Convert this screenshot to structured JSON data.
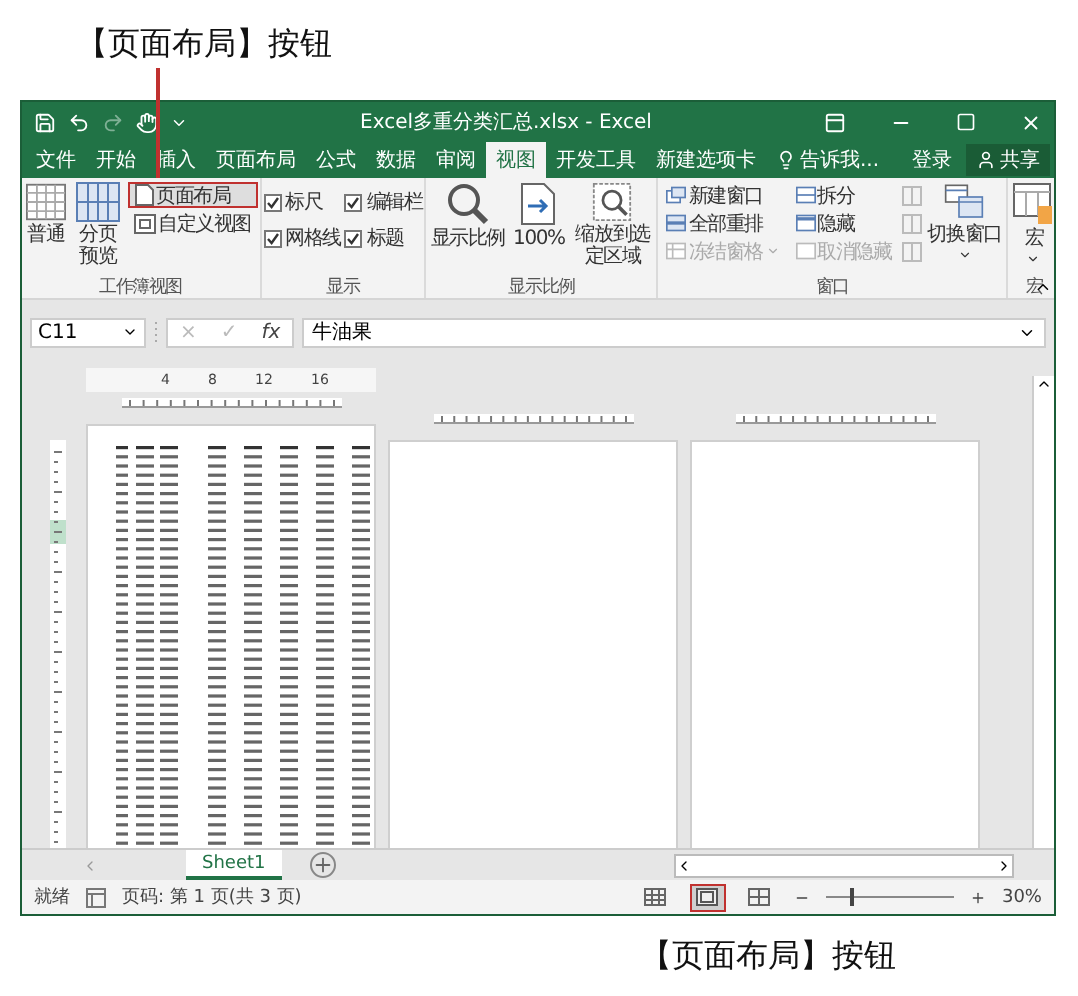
{
  "captions": {
    "top": "【页面布局】按钮",
    "bottom": "【页面布局】按钮"
  },
  "window": {
    "title": "Excel多重分类汇总.xlsx - Excel"
  },
  "tabs": [
    {
      "label": "文件",
      "selected": false
    },
    {
      "label": "开始",
      "selected": false
    },
    {
      "label": "插入",
      "selected": false
    },
    {
      "label": "页面布局",
      "selected": false
    },
    {
      "label": "公式",
      "selected": false
    },
    {
      "label": "数据",
      "selected": false
    },
    {
      "label": "审阅",
      "selected": false
    },
    {
      "label": "视图",
      "selected": true
    },
    {
      "label": "开发工具",
      "selected": false
    },
    {
      "label": "新建选项卡",
      "selected": false
    }
  ],
  "tell_me": "告诉我...",
  "sign_in": "登录",
  "share": "共享",
  "ribbon": {
    "groups": [
      {
        "name": "工作簿视图",
        "columns": [
          [
            {
              "kind": "large",
              "label": "普通",
              "menu": false
            }
          ],
          [
            {
              "kind": "large",
              "label": "分页预览",
              "menu": false
            }
          ],
          [
            {
              "kind": "small",
              "label": "页面布局",
              "highlighted": true,
              "disabled": false,
              "menu": false
            },
            {
              "kind": "small",
              "label": "自定义视图",
              "highlighted": false,
              "disabled": false,
              "menu": false
            }
          ]
        ]
      },
      {
        "name": "显示",
        "columns": [
          [
            {
              "kind": "check",
              "label": "标尺",
              "checked": true
            },
            {
              "kind": "check",
              "label": "网格线",
              "checked": true
            }
          ],
          [
            {
              "kind": "check",
              "label": "编辑栏",
              "checked": true
            },
            {
              "kind": "check",
              "label": "标题",
              "checked": true
            }
          ]
        ]
      },
      {
        "name": "显示比例",
        "columns": [
          [
            {
              "kind": "large",
              "label": "显示比例",
              "menu": false
            }
          ],
          [
            {
              "kind": "large",
              "label": "100%",
              "menu": false
            }
          ],
          [
            {
              "kind": "large",
              "label": "缩放到选定区域",
              "menu": false
            }
          ]
        ]
      },
      {
        "name": "窗口",
        "columns": [
          [
            {
              "kind": "small",
              "label": "新建窗口",
              "highlighted": false,
              "disabled": false,
              "menu": false
            },
            {
              "kind": "small",
              "label": "全部重排",
              "highlighted": false,
              "disabled": false,
              "menu": false
            },
            {
              "kind": "small",
              "label": "冻结窗格",
              "highlighted": false,
              "disabled": true,
              "menu": true
            }
          ],
          [
            {
              "kind": "small",
              "label": "拆分",
              "highlighted": false,
              "disabled": false,
              "menu": false
            },
            {
              "kind": "small",
              "label": "隐藏",
              "highlighted": false,
              "disabled": false,
              "menu": false
            },
            {
              "kind": "small",
              "label": "取消隐藏",
              "highlighted": false,
              "disabled": true,
              "menu": false
            }
          ],
          [
            {
              "kind": "icon_stack"
            }
          ],
          [
            {
              "kind": "large",
              "label": "切换窗口",
              "menu": true
            }
          ]
        ]
      },
      {
        "name": "宏",
        "columns": [
          [
            {
              "kind": "large",
              "label": "宏",
              "menu": true
            }
          ]
        ]
      }
    ]
  },
  "formula_bar": {
    "name_box": "C11",
    "buttons": [
      "×",
      "✓",
      "fx"
    ],
    "value": "牛油果"
  },
  "ruler_marks": [
    "4",
    "8",
    "12",
    "16"
  ],
  "sheet_tabs": [
    {
      "label": "Sheet1",
      "selected": true
    }
  ],
  "status_bar": {
    "ready": "就绪",
    "page": "页码: 第 1 页(共 3 页)",
    "views": [
      {
        "kind": "normal",
        "selected": false,
        "highlighted": false
      },
      {
        "kind": "page_layout",
        "selected": true,
        "highlighted": true
      },
      {
        "kind": "page_break",
        "selected": false,
        "highlighted": false
      }
    ],
    "zoom": {
      "level": 0.2,
      "reading": "30%"
    }
  }
}
